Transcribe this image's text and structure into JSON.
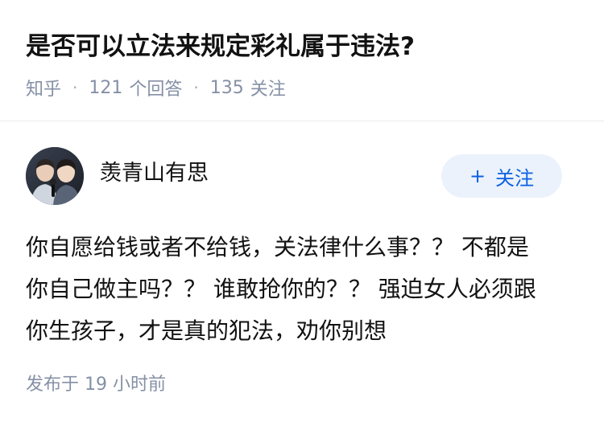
{
  "question": {
    "title": "是否可以立法来规定彩礼属于违法?",
    "source": "知乎",
    "answer_count": "121",
    "answer_label": "个回答",
    "follower_count": "135",
    "follower_label": "关注",
    "separator": "·"
  },
  "answer": {
    "author": {
      "name": "羡青山有思",
      "avatar_icon": "avatar-photo"
    },
    "follow_button": {
      "icon": "plus-icon",
      "icon_glyph": "+",
      "label": "关注"
    },
    "content_lines": [
      "你自愿给钱或者不给钱，关法律什么事？？ 不都是",
      "你自己做主吗？？ 谁敢抢你的？？ 强迫女人必须跟",
      "你生孩子，才是真的犯法，劝你别想"
    ],
    "publish_label": "发布于",
    "publish_time": "19 小时前"
  },
  "colors": {
    "title": "#121212",
    "meta": "#8590a6",
    "follow_bg": "#ebf2fb",
    "follow_text": "#0d60e3"
  }
}
